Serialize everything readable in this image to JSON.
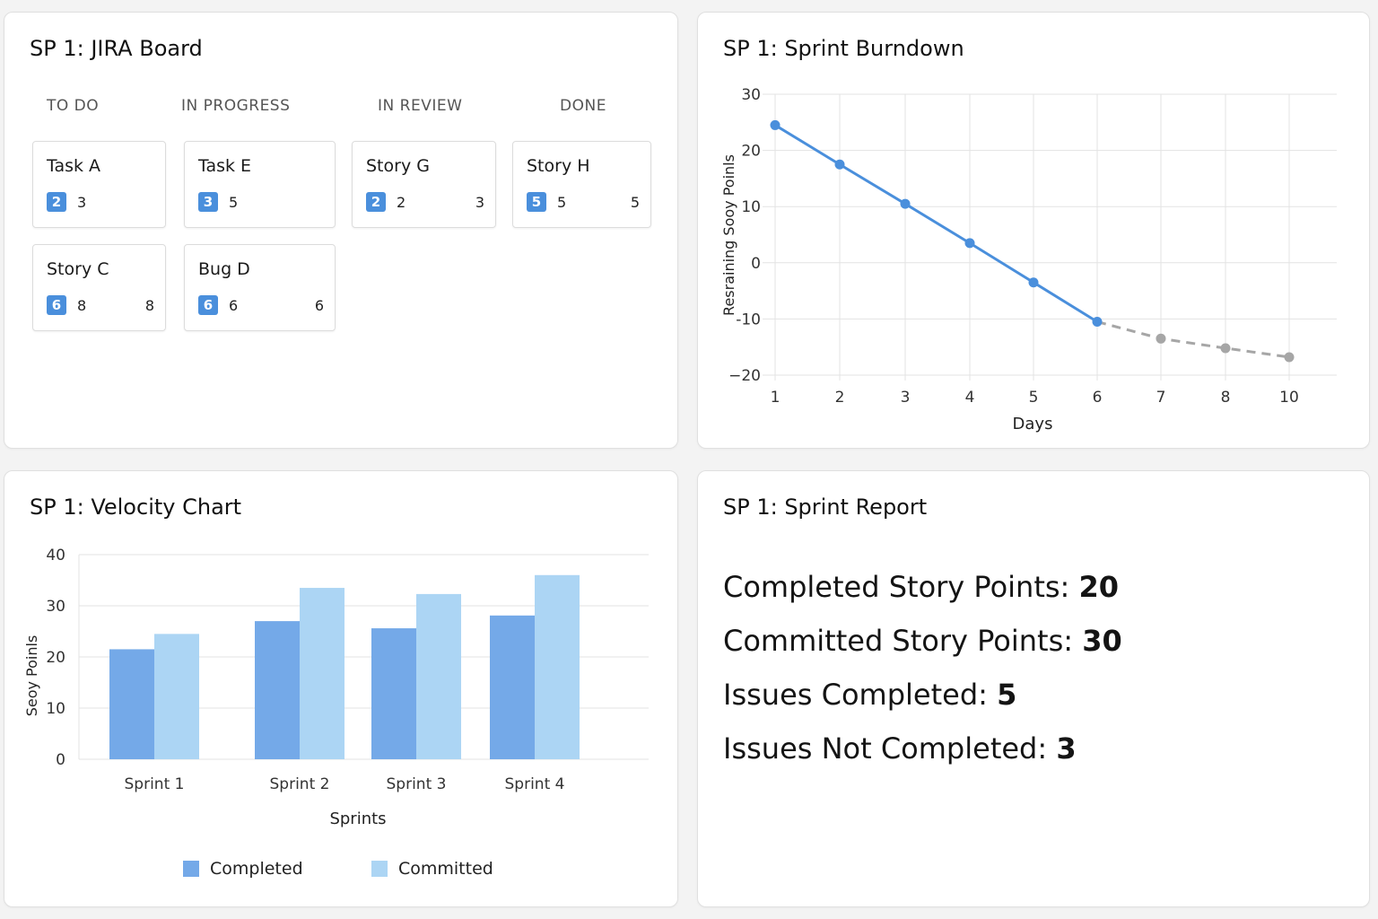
{
  "board": {
    "title": "SP 1: JIRA Board",
    "columns": [
      "TO DO",
      "IN PROGRESS",
      "IN REVIEW",
      "DONE"
    ],
    "cards": [
      {
        "title": "Task A",
        "badge": "2",
        "points": "3",
        "estimate": ""
      },
      {
        "title": "Story C",
        "badge": "6",
        "points": "8",
        "estimate": "8"
      },
      {
        "title": "Task E",
        "badge": "3",
        "points": "5",
        "estimate": ""
      },
      {
        "title": "Bug D",
        "badge": "6",
        "points": "6",
        "estimate": "6"
      },
      {
        "title": "Story G",
        "badge": "2",
        "points": "2",
        "estimate": "3"
      },
      {
        "title": "Story H",
        "badge": "5",
        "points": "5",
        "estimate": "5"
      }
    ]
  },
  "burndown": {
    "title": "SP 1: Sprint Burndown",
    "chart_data": {
      "type": "line",
      "xlabel": "Days",
      "ylabel": "Resraining Sooy Poinls",
      "x_ticks": [
        "1",
        "2",
        "3",
        "4",
        "5",
        "6",
        "7",
        "8",
        "10"
      ],
      "y_ticks": [
        "30",
        "20",
        "10",
        "0",
        "-10",
        "−20"
      ],
      "ylim": [
        -20,
        30
      ],
      "grid": true,
      "series": [
        {
          "style": "solid",
          "color": "#4a8fdc",
          "x": [
            "1",
            "2",
            "3",
            "4",
            "5",
            "6"
          ],
          "values": [
            24.5,
            17.5,
            10.5,
            3.5,
            -3.5,
            -10.5
          ]
        },
        {
          "style": "dashed",
          "color": "#a6a6a6",
          "x": [
            "6",
            "7",
            "8",
            "10"
          ],
          "values": [
            -10.5,
            -13.5,
            -15.2,
            -16.8
          ]
        }
      ]
    }
  },
  "velocity": {
    "title": "SP 1: Velocity Chart",
    "chart_data": {
      "type": "bar",
      "categories": [
        "Sprint 1",
        "Sprint 2",
        "Sprint 3",
        "Sprint 4"
      ],
      "xlabel": "Sprints",
      "ylabel": "Seoy Poinls",
      "y_ticks": [
        "40",
        "30",
        "20",
        "10",
        "0"
      ],
      "ylim": [
        0,
        40
      ],
      "grid": true,
      "legend_position": "bottom",
      "series": [
        {
          "name": "Completed",
          "color": "#74a9e8",
          "values": [
            21.5,
            27,
            25.6,
            28.1
          ]
        },
        {
          "name": "Committed",
          "color": "#acd5f4",
          "values": [
            24.5,
            33.5,
            32.3,
            36
          ]
        }
      ]
    }
  },
  "report": {
    "title": "SP 1: Sprint Report",
    "stats": [
      {
        "label": "Completed Story Points: ",
        "value": "20"
      },
      {
        "label": "Committed Story Points: ",
        "value": "30"
      },
      {
        "label": "Issues Completed: ",
        "value": "5"
      },
      {
        "label": "Issues Not Completed: ",
        "value": "3"
      }
    ]
  }
}
